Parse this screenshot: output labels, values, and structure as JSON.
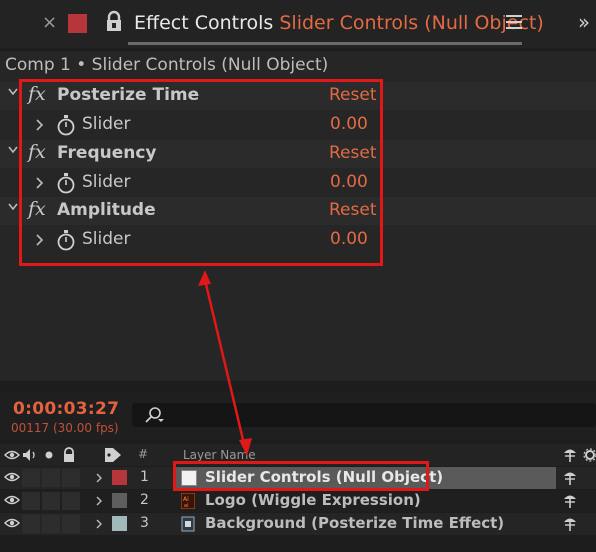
{
  "effect_controls": {
    "tab_title": "Effect Controls",
    "tab_layer": "Slider Controls (Null Object)",
    "comp_path": "Comp 1 • Slider Controls (Null Object)",
    "effects": [
      {
        "name": "Posterize Time",
        "reset": "Reset",
        "param": "Slider",
        "value": "0.00"
      },
      {
        "name": "Frequency",
        "reset": "Reset",
        "param": "Slider",
        "value": "0.00"
      },
      {
        "name": "Amplitude",
        "reset": "Reset",
        "param": "Slider",
        "value": "0.00"
      }
    ]
  },
  "timeline": {
    "timecode": "0:00:03:27",
    "frame_info": "00117 (30.00 fps)",
    "columns": {
      "number": "#",
      "layer_name": "Layer Name"
    },
    "layers": [
      {
        "number": "1",
        "name": "Slider Controls (Null Object)",
        "label_color": "#b7363b",
        "type": "null",
        "selected": true
      },
      {
        "number": "2",
        "name": "Logo (Wiggle Expression)",
        "label_color": "#5e5e5e",
        "type": "illustrator",
        "selected": false
      },
      {
        "number": "3",
        "name": "Background (Posterize Time Effect)",
        "label_color": "#9fbab9",
        "type": "footage",
        "selected": false
      }
    ]
  },
  "colors": {
    "accent": "#e36a43",
    "annotation": "#e01818"
  }
}
